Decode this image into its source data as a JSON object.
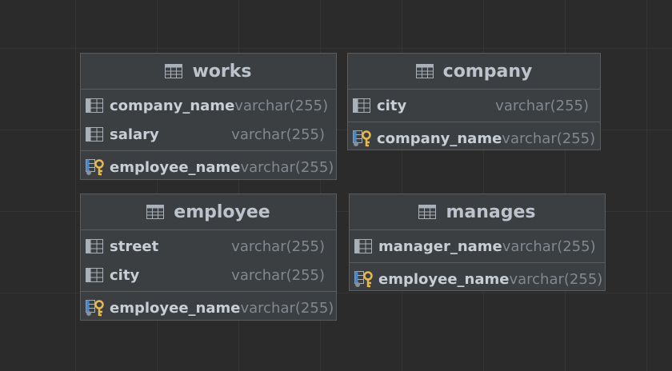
{
  "tables": {
    "works": {
      "title": "works",
      "columns": [
        {
          "name": "company_name",
          "type": "varchar(255)"
        },
        {
          "name": "salary",
          "type": "varchar(255)"
        }
      ],
      "keys": [
        {
          "name": "employee_name",
          "type": "varchar(255)"
        }
      ]
    },
    "company": {
      "title": "company",
      "columns": [
        {
          "name": "city",
          "type": "varchar(255)"
        }
      ],
      "keys": [
        {
          "name": "company_name",
          "type": "varchar(255)"
        }
      ]
    },
    "employee": {
      "title": "employee",
      "columns": [
        {
          "name": "street",
          "type": "varchar(255)"
        },
        {
          "name": "city",
          "type": "varchar(255)"
        }
      ],
      "keys": [
        {
          "name": "employee_name",
          "type": "varchar(255)"
        }
      ]
    },
    "manages": {
      "title": "manages",
      "columns": [
        {
          "name": "manager_name",
          "type": "varchar(255)"
        }
      ],
      "keys": [
        {
          "name": "employee_name",
          "type": "varchar(255)"
        }
      ]
    }
  },
  "icons": {
    "table": "table-icon",
    "column": "column-icon",
    "primary_key": "primary-key-column-icon"
  },
  "colors": {
    "background": "#2b2b2b",
    "table_bg": "#3c3f41",
    "border": "#5c5c5c",
    "title": "#bcc3cc",
    "column_name": "#c8ced6",
    "column_type": "#808890",
    "key_gold": "#e8b84a",
    "key_blue": "#4a87c4"
  }
}
